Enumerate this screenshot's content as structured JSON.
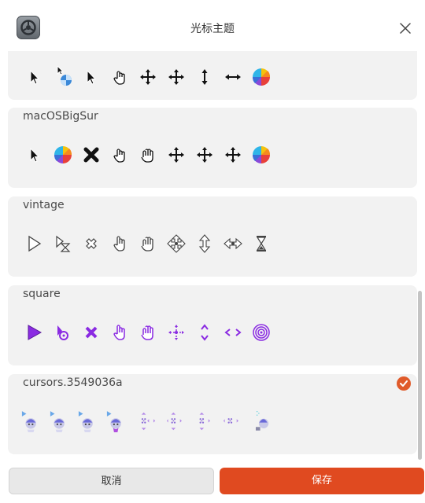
{
  "window": {
    "title": "光标主题",
    "app_icon": "settings-gear-icon",
    "close_icon": "close-icon"
  },
  "themes": [
    {
      "name": "",
      "cursors": [
        "arrow",
        "arrow-busy",
        "arrow",
        "hand",
        "move",
        "move",
        "resize-v",
        "resize-h",
        "busy-spinner"
      ]
    },
    {
      "name": "macOSBigSur",
      "cursors": [
        "arrow",
        "busy-spinner",
        "x-cursor",
        "hand",
        "grab",
        "move",
        "move",
        "move",
        "busy-spinner"
      ]
    },
    {
      "name": "vintage",
      "cursors": [
        "arrow",
        "hourglass-arrow",
        "x-cursor",
        "hand",
        "grab",
        "move",
        "resize-v",
        "resize-h",
        "hourglass"
      ]
    },
    {
      "name": "square",
      "cursors": [
        "arrow",
        "busy",
        "x-cursor",
        "hand",
        "grab",
        "move",
        "resize-v",
        "resize-h",
        "spiral"
      ]
    },
    {
      "name": "cursors.3549036a",
      "selected": true,
      "cursors": [
        "anime-arrow",
        "anime-arrow",
        "anime-arrow",
        "anime-arrow",
        "move",
        "move",
        "move",
        "move",
        "anime-partial"
      ]
    }
  ],
  "buttons": {
    "cancel": "取消",
    "save": "保存"
  },
  "colors": {
    "accent": "#e04a20",
    "check": "#e05a2a",
    "card": "#f2f2f2",
    "square_purple": "#8a2be2"
  }
}
